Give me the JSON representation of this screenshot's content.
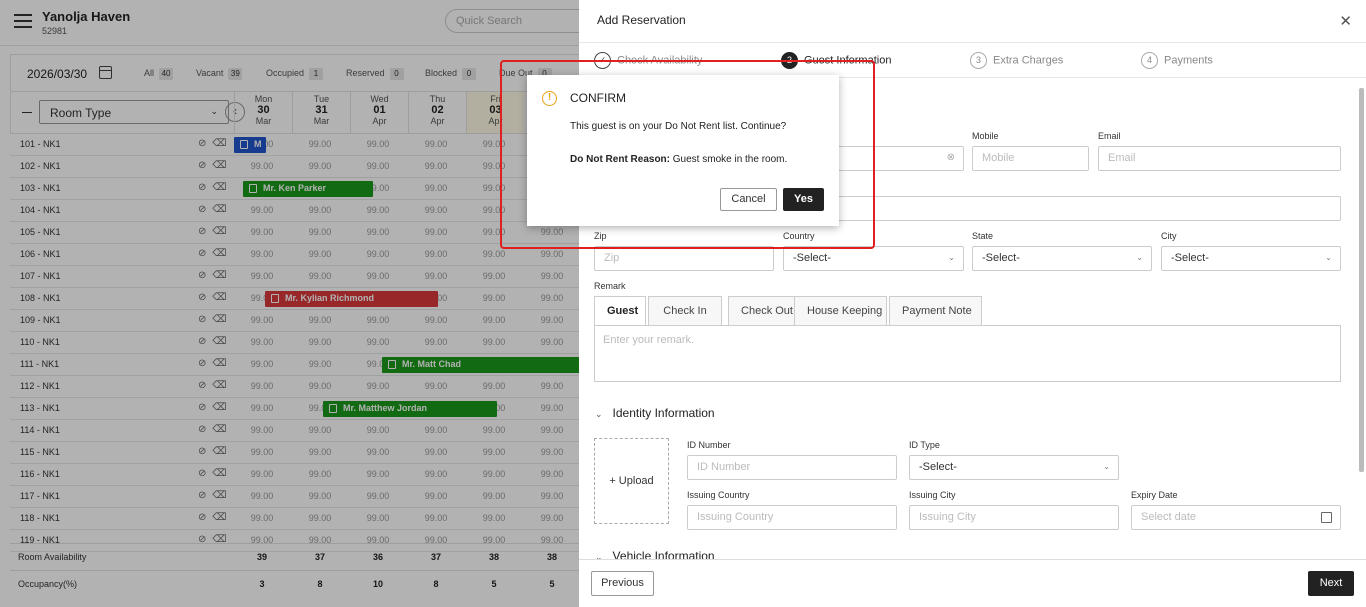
{
  "app": {
    "hotel_name": "Yanolja Haven",
    "hotel_id": "52981",
    "quick_search_placeholder": "Quick Search"
  },
  "filter": {
    "date": "2026/03/30",
    "stats": [
      {
        "label": "All",
        "count": "40"
      },
      {
        "label": "Vacant",
        "count": "39"
      },
      {
        "label": "Occupied",
        "count": "1"
      },
      {
        "label": "Reserved",
        "count": "0"
      },
      {
        "label": "Blocked",
        "count": "0"
      },
      {
        "label": "Due Out",
        "count": "0"
      }
    ]
  },
  "grid": {
    "room_type_label": "Room Type",
    "days": [
      {
        "dow": "Mon",
        "num": "30",
        "mon": "Mar"
      },
      {
        "dow": "Tue",
        "num": "31",
        "mon": "Mar"
      },
      {
        "dow": "Wed",
        "num": "01",
        "mon": "Apr"
      },
      {
        "dow": "Thu",
        "num": "02",
        "mon": "Apr"
      },
      {
        "dow": "Fri",
        "num": "03",
        "mon": "Apr"
      }
    ],
    "rate": "99.00",
    "rooms": [
      "101 - NK1",
      "102 - NK1",
      "103 - NK1",
      "104 - NK1",
      "105 - NK1",
      "106 - NK1",
      "107 - NK1",
      "108 - NK1",
      "109 - NK1",
      "110 - NK1",
      "111 - NK1",
      "112 - NK1",
      "113 - NK1",
      "114 - NK1",
      "115 - NK1",
      "116 - NK1",
      "117 - NK1",
      "118 - NK1",
      "119 - NK1"
    ],
    "bookings": [
      {
        "guest": "Mr. Ken Parker",
        "row": 2,
        "color": "#1a9a1a"
      },
      {
        "guest": "Mr. Kylian Richmond",
        "row": 7,
        "color": "#d9383a"
      },
      {
        "guest": "Mr. Matt Chad",
        "row": 10,
        "color": "#1a9a1a"
      },
      {
        "guest": "Mr. Matthew Jordan",
        "row": 12,
        "color": "#1a9a1a"
      },
      {
        "guest": "M",
        "row": 0,
        "color": "#2255cc"
      }
    ],
    "availability_label": "Room Availability",
    "availability": [
      "39",
      "37",
      "36",
      "37",
      "38",
      "38"
    ],
    "occupancy_label": "Occupancy(%)",
    "occupancy": [
      "3",
      "8",
      "10",
      "8",
      "5",
      "5"
    ]
  },
  "panel": {
    "title": "Add Reservation",
    "steps": [
      {
        "num": "✓",
        "label": "Check Availability"
      },
      {
        "num": "2",
        "label": "Guest Information"
      },
      {
        "num": "3",
        "label": "Extra Charges"
      },
      {
        "num": "4",
        "label": "Payments"
      }
    ],
    "fields": {
      "mobile_label": "Mobile",
      "mobile_placeholder": "Mobile",
      "email_label": "Email",
      "email_placeholder": "Email",
      "zip_label": "Zip",
      "zip_placeholder": "Zip",
      "country_label": "Country",
      "country_value": "-Select-",
      "state_label": "State",
      "state_value": "-Select-",
      "city_label": "City",
      "city_value": "-Select-",
      "remark_label": "Remark",
      "remark_placeholder": "Enter your remark."
    },
    "remark_tabs": [
      "Guest",
      "Check In",
      "Check Out",
      "House Keeping",
      "Payment Note"
    ],
    "identity": {
      "title": "Identity Information",
      "upload": "+ Upload",
      "id_number_label": "ID Number",
      "id_number_placeholder": "ID Number",
      "id_type_label": "ID Type",
      "id_type_value": "-Select-",
      "issuing_country_label": "Issuing Country",
      "issuing_country_placeholder": "Issuing Country",
      "issuing_city_label": "Issuing City",
      "issuing_city_placeholder": "Issuing City",
      "expiry_label": "Expiry Date",
      "expiry_placeholder": "Select date"
    },
    "vehicle_title": "Vehicle Information",
    "prev_label": "Previous",
    "next_label": "Next"
  },
  "modal": {
    "title": "CONFIRM",
    "message": "This guest is on your Do Not Rent list. Continue?",
    "reason_label": "Do Not Rent Reason:",
    "reason_text": " Guest smoke in the room.",
    "cancel_label": "Cancel",
    "yes_label": "Yes"
  },
  "colors": {
    "accent": "#222222",
    "warning": "#e8a317",
    "highlight": "#e02020",
    "occupied": "#1a9a1a",
    "blocked": "#d9383a"
  }
}
